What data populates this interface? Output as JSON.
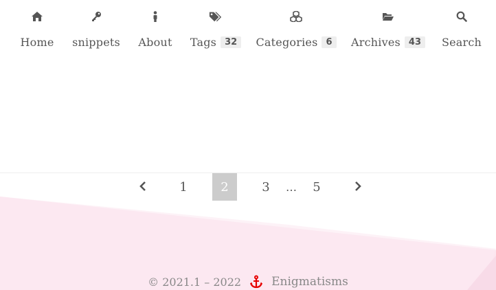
{
  "nav": {
    "items": [
      {
        "label": "Home",
        "icon": "home-icon"
      },
      {
        "label": "snippets",
        "icon": "key-icon"
      },
      {
        "label": "About",
        "icon": "person-icon"
      },
      {
        "label": "Tags",
        "icon": "tags-icon",
        "count": "32"
      },
      {
        "label": "Categories",
        "icon": "cubes-icon",
        "count": "6"
      },
      {
        "label": "Archives",
        "icon": "folder-open-icon",
        "count": "43"
      },
      {
        "label": "Search",
        "icon": "search-icon"
      }
    ]
  },
  "pagination": {
    "prev_icon": "chevron-left-icon",
    "next_icon": "chevron-right-icon",
    "pages": [
      "1",
      "2",
      "3",
      "…",
      "5"
    ],
    "current": "2"
  },
  "footer": {
    "copyright": "© 2021.1 – 2022",
    "icon": "anchor-icon",
    "site_name": "Enigmatisms",
    "accent_color": "#e60000"
  },
  "colors": {
    "text": "#555555",
    "decoration": "#fce4ee",
    "current_page_bg": "#cccccc"
  }
}
